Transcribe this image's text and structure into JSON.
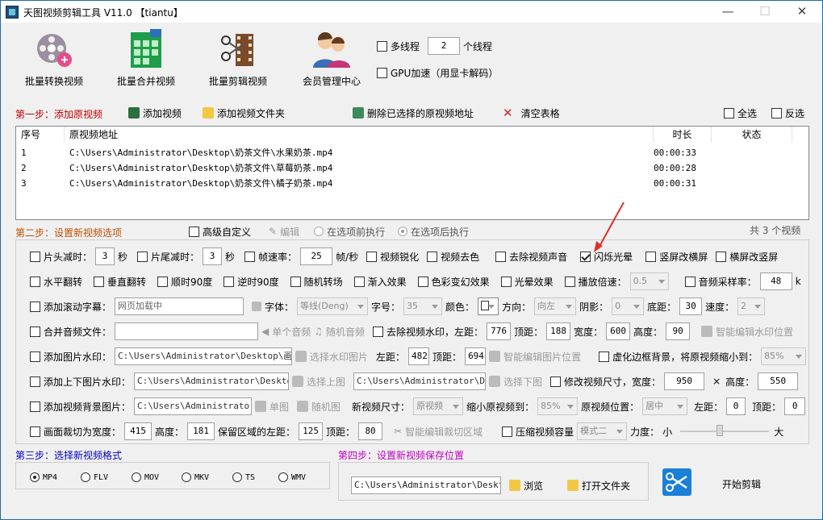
{
  "window": {
    "title": "天图视频剪辑工具 V11.0 【tiantu】",
    "min": "—",
    "max": "☐",
    "close": "✕"
  },
  "toolbar": {
    "batch_convert": "批量转换视频",
    "batch_merge": "批量合并视频",
    "batch_cut": "批量剪辑视频",
    "member_center": "会员管理中心"
  },
  "threads": {
    "multi_label": "多线程",
    "count": "2",
    "unit": "个线程",
    "gpu_label": "GPU加速（用显卡解码）"
  },
  "step1": {
    "title": "第一步：添加原视频",
    "add_video": "添加视频",
    "add_folder": "添加视频文件夹",
    "delete_selected": "删除已选择的原视频地址",
    "clear_table": "清空表格",
    "select_all": "全选",
    "invert": "反选"
  },
  "table": {
    "headers": [
      "序号",
      "原视频地址",
      "时长",
      "状态"
    ],
    "rows": [
      {
        "no": "1",
        "path": "C:\\Users\\Administrator\\Desktop\\奶茶文件\\水果奶茶.mp4",
        "duration": "00:00:33",
        "status": ""
      },
      {
        "no": "2",
        "path": "C:\\Users\\Administrator\\Desktop\\奶茶文件\\草莓奶茶.mp4",
        "duration": "00:00:28",
        "status": ""
      },
      {
        "no": "3",
        "path": "C:\\Users\\Administrator\\Desktop\\奶茶文件\\橘子奶茶.mp4",
        "duration": "00:00:31",
        "status": ""
      }
    ],
    "count_text": "共 3 个视频"
  },
  "step2": {
    "title": "第二步：设置新视频选项",
    "advanced": "高级自定义",
    "edit": "编辑",
    "before": "在选项前执行",
    "after": "在选项后执行"
  },
  "opts": {
    "r1": {
      "head_trim": "片头减时：",
      "head_val": "3",
      "sec1": "秒",
      "tail_trim": "片尾减时：",
      "tail_val": "3",
      "sec2": "秒",
      "fps": "帧速率：",
      "fps_val": "25",
      "fps_unit": "帧/秒",
      "sharpen": "视频锐化",
      "desat": "视频去色",
      "mute": "去除视频声音",
      "flash": "闪烁光晕",
      "v2h": "竖屏改横屏",
      "h2v": "横屏改竖屏"
    },
    "r2": {
      "hflip": "水平翻转",
      "vflip": "垂直翻转",
      "cw90": "顺时90度",
      "ccw90": "逆时90度",
      "rand_trans": "随机转场",
      "fade_in": "渐入效果",
      "color": "色彩变幻效果",
      "light": "光晕效果",
      "speed": "播放倍速：",
      "speed_val": "0.5",
      "sample": "音频采样率：",
      "sample_val": "48",
      "k": "k"
    },
    "r3": {
      "scroll": "添加滚动字幕：",
      "scroll_text": "网页加载中",
      "font": "字体：",
      "font_val": "等线(Deng)",
      "size": "字号：",
      "size_val": "35",
      "color": "颜色：",
      "dir": "方向：",
      "dir_val": "向左",
      "shadow": "阴影：",
      "shadow_val": "0",
      "bottom": "底距：",
      "bottom_val": "30",
      "speed": "速度：",
      "speed_val": "2"
    },
    "r4": {
      "merge_audio": "合并音频文件：",
      "single_audio": "单个音频",
      "rand_audio": "随机音频",
      "remove_wm": "去除视频水印，左距：",
      "left": "776",
      "top_lbl": "顶距：",
      "top": "188",
      "width_lbl": "宽度：",
      "width": "600",
      "height_lbl": "高度：",
      "height": "90",
      "smart_wm": "智能编辑水印位置"
    },
    "r5": {
      "img_wm": "添加图片水印：",
      "img_path": "C:\\Users\\Administrator\\Desktop\\画中画",
      "choose": "选择水印图片",
      "left_lbl": "左距：",
      "left": "482",
      "top_lbl": "顶距：",
      "top": "694",
      "smart": "智能编辑图片位置",
      "blur": "虚化边框背景，将原视频缩小到：",
      "blur_val": "85%"
    },
    "r6": {
      "tb_wm": "添加上下图片水印：",
      "top_path": "C:\\Users\\Administrator\\Desktop\\背",
      "choose_top": "选择上图",
      "bottom_path": "C:\\Users\\Administrator\\Desk",
      "choose_bottom": "选择下图",
      "resize": "修改视频尺寸，宽度：",
      "w": "950",
      "x": "×",
      "h_lbl": "高度：",
      "h": "550"
    },
    "r7": {
      "bg": "添加视频背景图片：",
      "bg_path": "C:\\Users\\Administrator\\D",
      "single": "单图",
      "random": "随机图",
      "new_size": "新视频尺寸：",
      "new_size_val": "原视频",
      "shrink": "缩小原视频到：",
      "shrink_val": "85%",
      "pos": "原视频位置：",
      "pos_val": "居中",
      "left_lbl": "左距：",
      "left": "0",
      "top_lbl": "顶距：",
      "top": "0"
    },
    "r8": {
      "crop": "画面裁切为宽度：",
      "w": "415",
      "h_lbl": "高度：",
      "h": "181",
      "keep": "保留区域的左距：",
      "left": "125",
      "top_lbl": "顶距：",
      "top": "80",
      "smart_crop": "智能编辑裁切区域",
      "compress": "压缩视频容量",
      "mode": "模式二",
      "strength": "力度：",
      "small": "小",
      "big": "大"
    }
  },
  "step3": {
    "title": "第三步：选择新视频格式",
    "formats": [
      "MP4",
      "FLV",
      "MOV",
      "MKV",
      "TS",
      "WMV"
    ]
  },
  "step4": {
    "title": "第四步：设置新视频保存位置",
    "path": "C:\\Users\\Administrator\\Desktop\\",
    "browse": "浏览",
    "open_folder": "打开文件夹"
  },
  "start": "开始剪辑"
}
